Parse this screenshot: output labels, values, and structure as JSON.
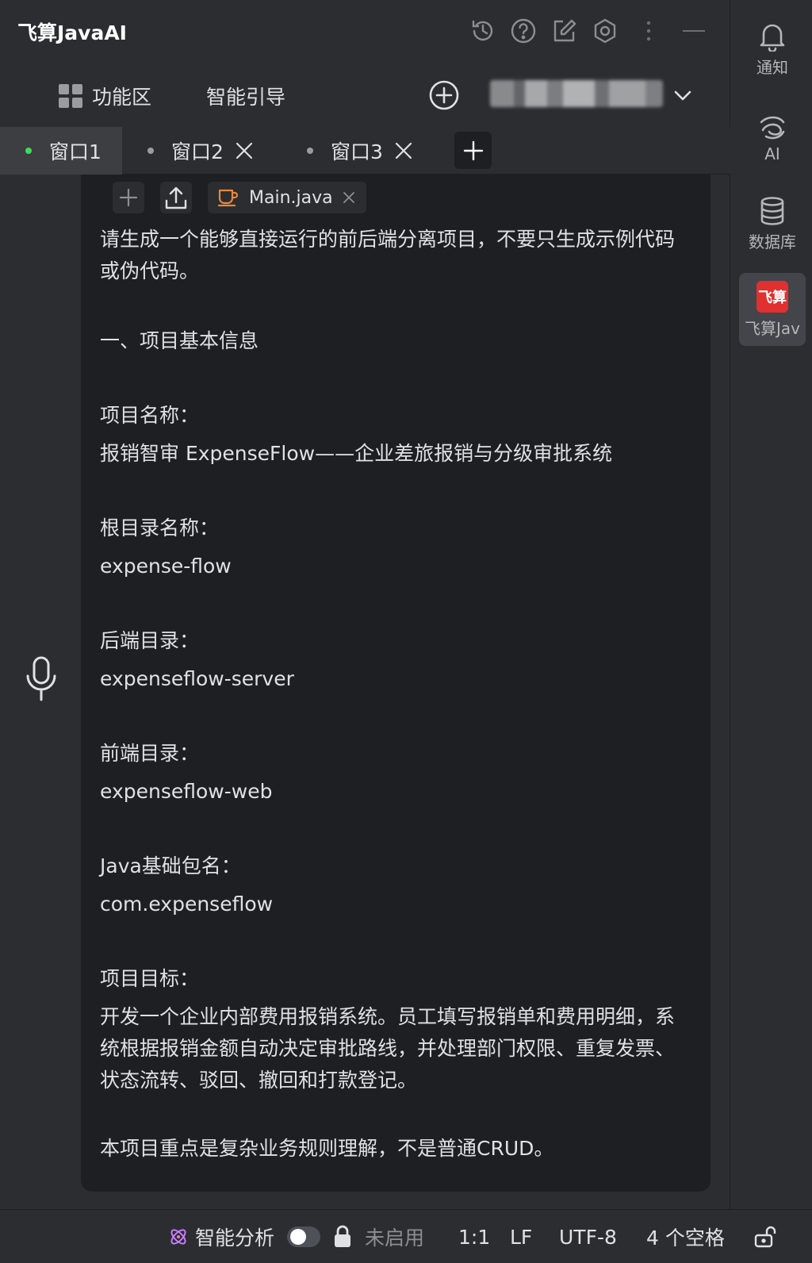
{
  "app": {
    "title": "飞算JavaAI"
  },
  "toolbar": {
    "function_area_label": "功能区",
    "smart_guide_label": "智能引导"
  },
  "tabs": [
    {
      "label": "窗口1",
      "active": true
    },
    {
      "label": "窗口2",
      "active": false
    },
    {
      "label": "窗口3",
      "active": false
    }
  ],
  "attachment": {
    "file_name": "Main.java"
  },
  "message": {
    "lines": [
      "请生成一个能够直接运行的前后端分离项目，不要只生成示例代码或伪代码。",
      "一、项目基本信息",
      "项目名称：",
      "报销智审 ExpenseFlow——企业差旅报销与分级审批系统",
      "根目录名称：",
      "expense-flow",
      "后端目录：",
      "expenseflow-server",
      "前端目录：",
      "expenseflow-web",
      "Java基础包名：",
      "com.expenseflow",
      "项目目标：",
      "开发一个企业内部费用报销系统。员工填写报销单和费用明细，系统根据报销金额自动决定审批路线，并处理部门权限、重复发票、状态流转、驳回、撤回和打款登记。",
      "本项目重点是复杂业务规则理解，不是普通CRUD。"
    ]
  },
  "sidebar": {
    "items": [
      {
        "label": "通知",
        "icon": "bell-icon"
      },
      {
        "label": "AI",
        "icon": "ai-icon"
      },
      {
        "label": "数据库",
        "icon": "database-icon"
      },
      {
        "label": "飞算Jav",
        "icon": "feisuan-logo-icon",
        "badge": "飞算"
      }
    ]
  },
  "statusbar": {
    "smart_analysis_label": "智能分析",
    "disabled_label": "未启用",
    "cursor_position": "1:1",
    "line_ending": "LF",
    "encoding": "UTF-8",
    "indent": "4 个空格"
  },
  "colors": {
    "background": "#2b2d30",
    "panel": "#1e1f22",
    "active_dot": "#3ddc5a",
    "logo_red": "#e0302f",
    "java_orange": "#e8873a"
  }
}
